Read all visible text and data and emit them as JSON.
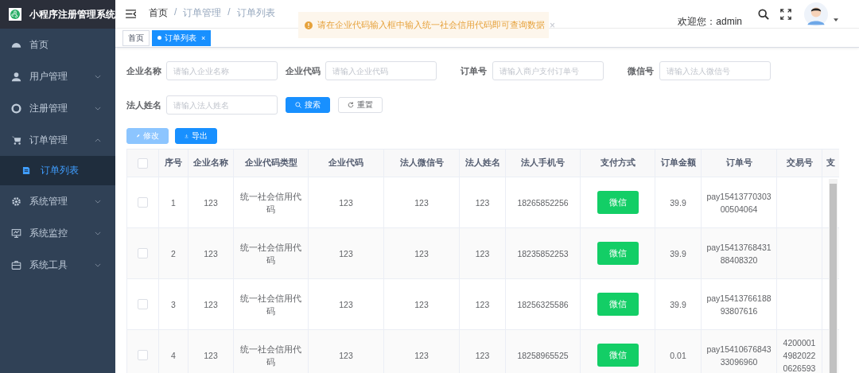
{
  "sidebar": {
    "title": "小程序注册管理系统",
    "items": [
      {
        "label": "首页",
        "kind": "link"
      },
      {
        "label": "用户管理",
        "kind": "group",
        "expanded": false
      },
      {
        "label": "注册管理",
        "kind": "group",
        "expanded": false
      },
      {
        "label": "订单管理",
        "kind": "group",
        "expanded": true,
        "children": [
          {
            "label": "订单列表",
            "selected": true
          }
        ]
      },
      {
        "label": "系统管理",
        "kind": "group",
        "expanded": false
      },
      {
        "label": "系统监控",
        "kind": "group",
        "expanded": false
      },
      {
        "label": "系统工具",
        "kind": "group",
        "expanded": false
      }
    ]
  },
  "breadcrumb": {
    "separator": "/",
    "items": [
      "首页",
      "订单管理",
      "订单列表"
    ]
  },
  "alert": {
    "text": "请在企业代码输入框中输入统一社会信用代码即可查询数据",
    "close": "×"
  },
  "welcome": "欢迎您：admin",
  "tabs": [
    {
      "label": "首页",
      "selected": false
    },
    {
      "label": "订单列表",
      "selected": true,
      "close": "×"
    }
  ],
  "filters": [
    {
      "label": "企业名称",
      "placeholder": "请输入企业名称"
    },
    {
      "label": "企业代码",
      "placeholder": "请输入企业代码"
    },
    {
      "label": "订单号",
      "placeholder": "请输入商户支付订单号"
    },
    {
      "label": "微信号",
      "placeholder": "请输入法人微信号"
    },
    {
      "label": "法人姓名",
      "placeholder": "请输入法人姓名"
    }
  ],
  "search_button": "搜索",
  "reset_button": "重置",
  "toolbar": [
    {
      "label": "修改",
      "disabled": true,
      "kind": "edit"
    },
    {
      "label": "导出",
      "disabled": false,
      "kind": "export"
    }
  ],
  "table": {
    "select_all": {
      "checked": false
    },
    "columns": [
      "序号",
      "企业名称",
      "企业代码类型",
      "企业代码",
      "法人微信号",
      "法人姓名",
      "法人手机号",
      "支付方式",
      "订单金额",
      "订单号",
      "交易号",
      "支"
    ],
    "rows": [
      {
        "checked": false,
        "cells": [
          "1",
          "123",
          "统一社会信用代码",
          "123",
          "123",
          "123",
          "18265852256",
          "微信",
          "39.9",
          "pay1541377030300504064",
          ""
        ]
      },
      {
        "checked": false,
        "cells": [
          "2",
          "123",
          "统一社会信用代码",
          "123",
          "123",
          "123",
          "18235852253",
          "微信",
          "39.9",
          "pay1541376843188408320",
          ""
        ]
      },
      {
        "checked": false,
        "cells": [
          "3",
          "123",
          "统一社会信用代码",
          "123",
          "123",
          "123",
          "18256325586",
          "微信",
          "39.9",
          "pay1541376618893807616",
          ""
        ]
      },
      {
        "checked": false,
        "cells": [
          "4",
          "123",
          "统一社会信用代码",
          "123",
          "123",
          "123",
          "18258965525",
          "微信",
          "0.01",
          "pay1541067684333096960",
          "420000149820220626593"
        ]
      }
    ]
  }
}
